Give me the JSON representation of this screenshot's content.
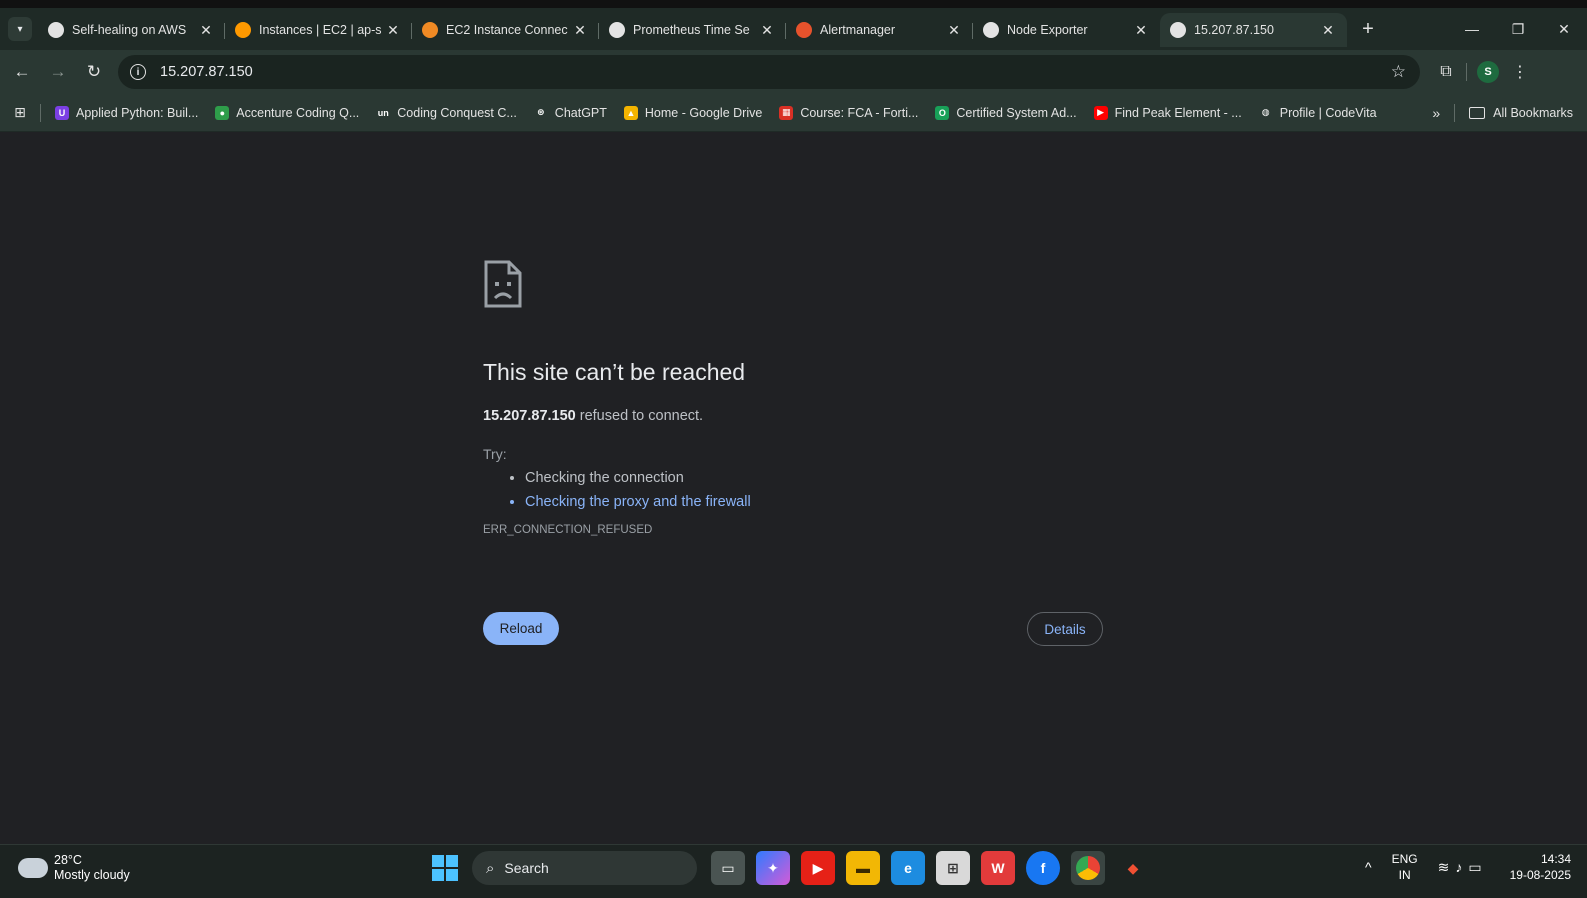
{
  "tabs": [
    {
      "title": "Self-healing on AWS",
      "favicon": "openai-icon",
      "color": "#e3e3e3"
    },
    {
      "title": "Instances | EC2 | ap-s",
      "favicon": "aws-ec2-icon",
      "color": "#ff9900"
    },
    {
      "title": "EC2 Instance Connec",
      "favicon": "aws-hex-icon",
      "color": "#f08a24"
    },
    {
      "title": "Prometheus Time Se",
      "favicon": "globe-icon",
      "color": "#e3e3e3"
    },
    {
      "title": "Alertmanager",
      "favicon": "prometheus-icon",
      "color": "#e6522c"
    },
    {
      "title": "Node Exporter",
      "favicon": "globe-icon",
      "color": "#e3e3e3"
    },
    {
      "title": "15.207.87.150",
      "favicon": "globe-icon",
      "color": "#e3e3e3",
      "active": true
    }
  ],
  "address": {
    "url": "15.207.87.150"
  },
  "profile": {
    "initial": "S"
  },
  "bookmarks": [
    {
      "label": "Applied Python: Buil...",
      "color": "#7b3fe4",
      "glyph": "U"
    },
    {
      "label": "Accenture Coding Q...",
      "color": "#2e9d4a",
      "glyph": "●"
    },
    {
      "label": "Coding Conquest C...",
      "color": "#2a3833",
      "glyph": "un"
    },
    {
      "label": "ChatGPT",
      "color": "#2a3833",
      "glyph": "⊛"
    },
    {
      "label": "Home - Google Drive",
      "color": "#f4b400",
      "glyph": "▲"
    },
    {
      "label": "Course: FCA - Forti...",
      "color": "#d93025",
      "glyph": "▦"
    },
    {
      "label": "Certified System Ad...",
      "color": "#18a058",
      "glyph": "O"
    },
    {
      "label": "Find Peak Element - ...",
      "color": "#ff0000",
      "glyph": "▶"
    },
    {
      "label": "Profile | CodeVita",
      "color": "#2a3833",
      "glyph": "◍"
    }
  ],
  "all_bookmarks_label": "All Bookmarks",
  "error": {
    "title": "This site can’t be reached",
    "host": "15.207.87.150",
    "desc_suffix": " refused to connect.",
    "try_label": "Try:",
    "suggestions": [
      "Checking the connection",
      "Checking the proxy and the firewall"
    ],
    "code": "ERR_CONNECTION_REFUSED",
    "reload_label": "Reload",
    "details_label": "Details"
  },
  "taskbar": {
    "temperature": "28°C",
    "weather": "Mostly cloudy",
    "search_label": "Search",
    "lang_top": "ENG",
    "lang_bottom": "IN",
    "time": "14:34",
    "date": "19-08-2025"
  }
}
